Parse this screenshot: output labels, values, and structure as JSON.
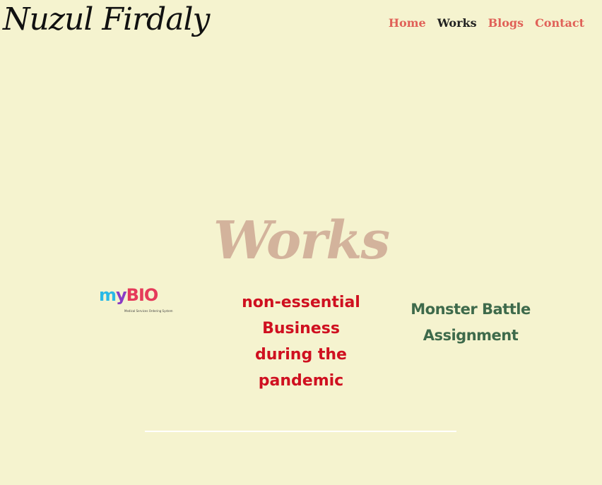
{
  "header": {
    "brand": "Nuzul Firdaly",
    "nav": [
      {
        "label": "Home",
        "active": false
      },
      {
        "label": "Works",
        "active": true
      },
      {
        "label": "Blogs",
        "active": false
      },
      {
        "label": "Contact",
        "active": false
      }
    ]
  },
  "hero": {
    "title": "Works"
  },
  "works": [
    {
      "logo_parts": {
        "m": "m",
        "y": "y",
        "b": "B",
        "io": "IO"
      },
      "tagline": "Medical Services Ordering System"
    },
    {
      "title": "non-essential Business during the pandemic"
    },
    {
      "title": "Monster Battle Assignment"
    }
  ],
  "colors": {
    "background": "#f5f3cf",
    "nav_inactive": "#e06158",
    "nav_active": "#222222",
    "hero_title": "#d3b39c",
    "business_title": "#cf1020",
    "monster_title": "#3e6a4b"
  }
}
